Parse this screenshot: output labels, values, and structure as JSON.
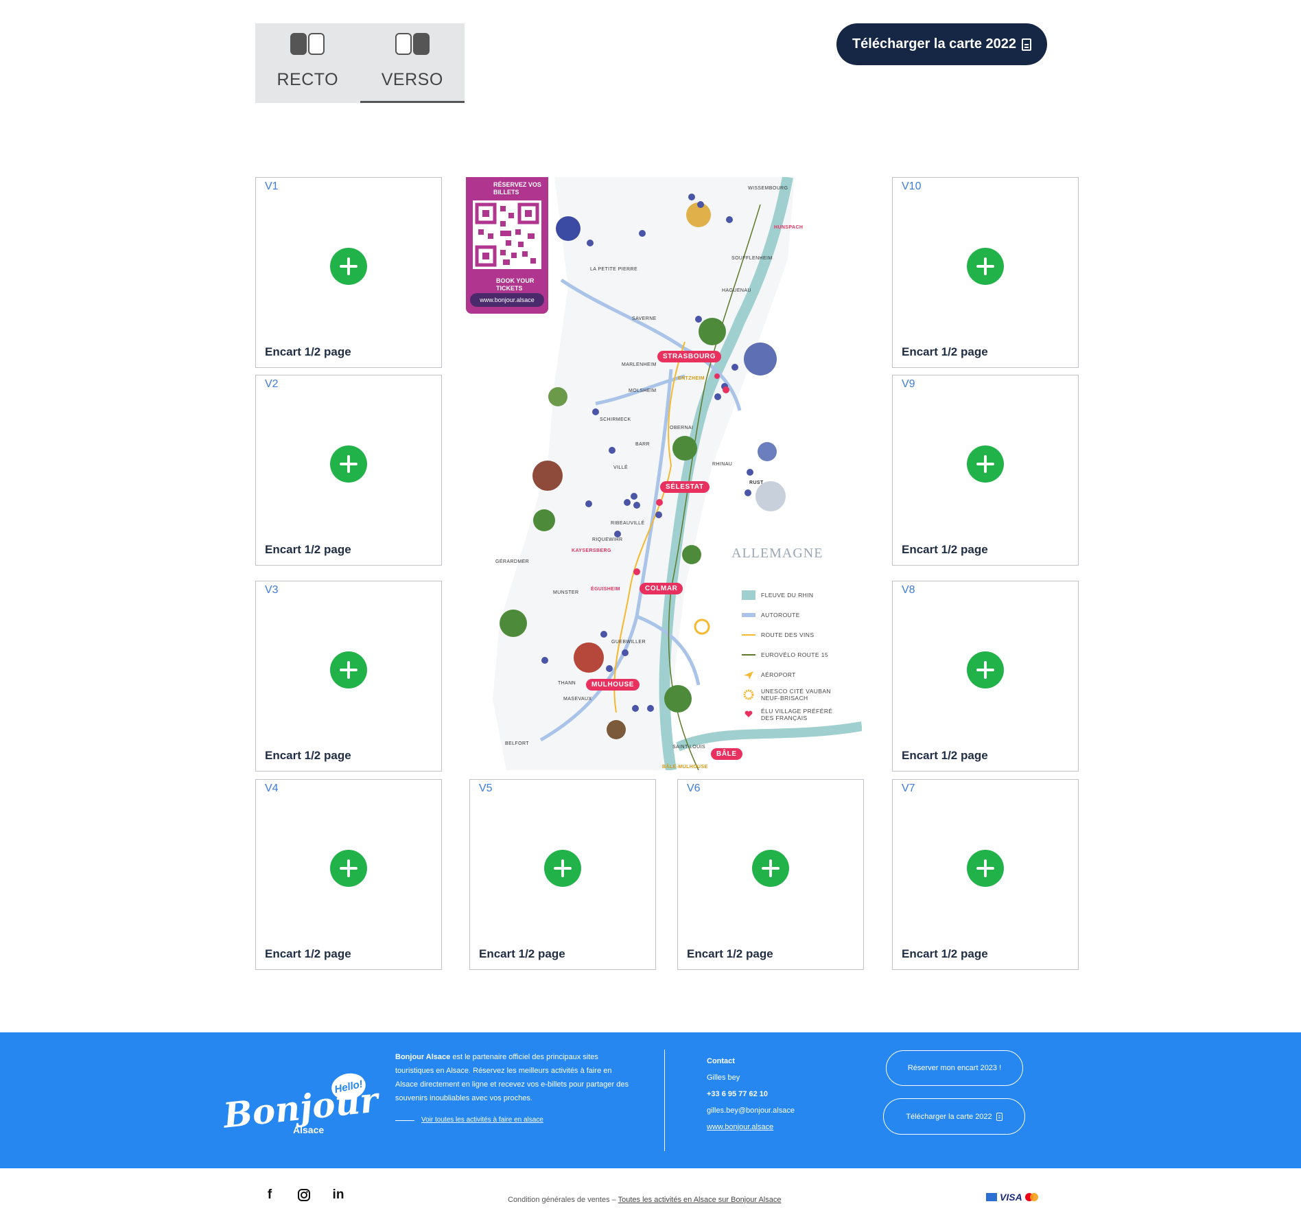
{
  "toggle": {
    "tabs": [
      {
        "label": "RECTO",
        "icon": "recto-pages-icon",
        "active": false
      },
      {
        "label": "VERSO",
        "icon": "verso-pages-icon",
        "active": true
      }
    ]
  },
  "header": {
    "download_label": "Télécharger la carte 2022",
    "download_icon": "pdf-icon"
  },
  "slots": {
    "caption": "Encart 1/2 page",
    "add_icon": "plus-circle-icon",
    "add_color": "#21b24a",
    "items": [
      {
        "code": "V1"
      },
      {
        "code": "V2"
      },
      {
        "code": "V3"
      },
      {
        "code": "V4"
      },
      {
        "code": "V5"
      },
      {
        "code": "V6"
      },
      {
        "code": "V7"
      },
      {
        "code": "V8"
      },
      {
        "code": "V9"
      },
      {
        "code": "V10"
      }
    ]
  },
  "map": {
    "qr": {
      "top_text": "RÉSERVEZ VOS BILLETS",
      "bottom_text": "BOOK YOUR TICKETS",
      "url": "www.bonjour.alsace"
    },
    "cities": {
      "strasbourg": "STRASBOURG",
      "selestat": "SÉLESTAT",
      "colmar": "COLMAR",
      "mulhouse": "MULHOUSE",
      "bale": "BÂLE"
    },
    "places": {
      "wissembourg": "WISSEMBOURG",
      "hunspach": "HUNSPACH",
      "petite_pierre": "LA PETITE PIERRE",
      "soufflenheim": "SOUFFLENHEIM",
      "haguenau": "HAGUENAU",
      "saverne": "SAVERNE",
      "marlenheim": "MARLENHEIM",
      "entzheim": "ENTZHEIM",
      "molsheim": "MOLSHEIM",
      "schirmeck": "SCHIRMECK",
      "obernai": "OBERNAI",
      "barr": "BARR",
      "rhinau": "RHINAU",
      "rust": "RUST",
      "ville": "VILLÉ",
      "ribeauville": "RIBEAUVILLÉ",
      "riquewihr": "RIQUEWIHR",
      "kaysersberg": "KAYSERSBERG",
      "gerardmer": "GÉRARDMER",
      "munster": "MUNSTER",
      "eguisheim": "ÉGUISHEIM",
      "guebwiller": "GUEBWILLER",
      "thann": "THANN",
      "masevaux": "MASEVAUX",
      "belfort": "BELFORT",
      "saint_louis": "SAINT-LOUIS",
      "bale_mulhouse": "BÂLE-MULHOUSE"
    },
    "country": "ALLEMAGNE",
    "legend": [
      {
        "label": "FLEUVE DU RHIN",
        "icon": "river-swatch-icon"
      },
      {
        "label": "AUTOROUTE",
        "icon": "highway-swatch-icon"
      },
      {
        "label": "ROUTE DES VINS",
        "icon": "wine-route-swatch-icon"
      },
      {
        "label": "EUROVÉLO ROUTE 15",
        "icon": "eurovelo-swatch-icon"
      },
      {
        "label": "AÉROPORT",
        "icon": "airport-icon"
      },
      {
        "label": "UNESCO CITÉ VAUBAN NEUF-BRISACH",
        "icon": "unesco-sun-icon"
      },
      {
        "label": "ÉLU VILLAGE PRÉFÉRÉ DES FRANÇAIS",
        "icon": "heart-icon"
      }
    ],
    "colors": {
      "river": "#9fd0cf",
      "highway": "#a9c4e8",
      "wine_route": "#f5b82e",
      "eurovelo": "#5c7a2a",
      "city": "#e8315f",
      "marker": "#4a55a8"
    }
  },
  "footer": {
    "logo": {
      "word": "Bonjour",
      "sub": "Alsace",
      "bubble": "Hello!"
    },
    "about": {
      "brand": "Bonjour Alsace",
      "text": " est le partenaire officiel des principaux sites touristiques en Alsace. Réservez les meilleurs activités à faire en Alsace directement en ligne et recevez vos e-billets pour partager des souvenirs inoubliables avec vos proches.",
      "link": "Voir toutes les activités à faire en alsace"
    },
    "contact": {
      "title": "Contact",
      "name": "Gilles bey",
      "phone": "+33 6 95 77 62 10",
      "email": "gilles.bey@bonjour.alsace",
      "website": "www.bonjour.alsace"
    },
    "buttons": {
      "reserve": "Réserver mon encart 2023 !",
      "download": "Télécharger la carte 2022"
    },
    "bg_color": "#2587ef"
  },
  "bottom": {
    "social": [
      {
        "icon": "facebook-icon",
        "glyph": "f"
      },
      {
        "icon": "instagram-icon",
        "glyph": ""
      },
      {
        "icon": "linkedin-icon",
        "glyph": "in"
      }
    ],
    "legal_prefix": "Condition générales de ventes – ",
    "legal_link": "Toutes les activités en Alsace sur Bonjour Alsace",
    "cards": {
      "visa": "VISA"
    }
  }
}
